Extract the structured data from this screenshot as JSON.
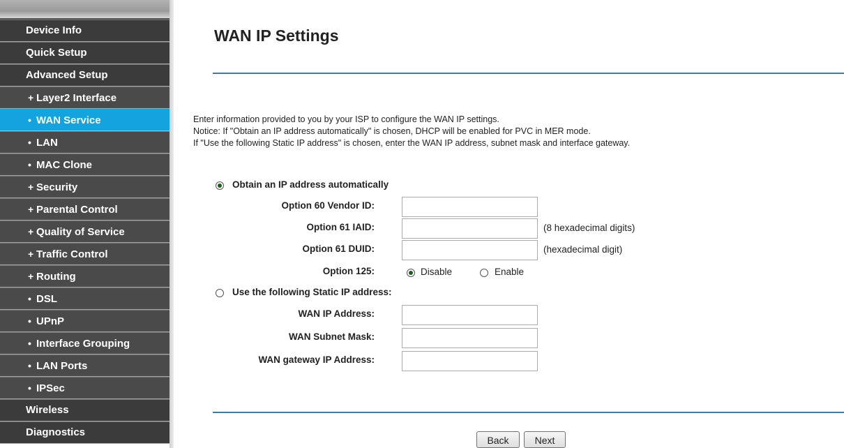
{
  "sidebar": {
    "items": [
      {
        "label": "Device Info",
        "type": "top"
      },
      {
        "label": "Quick Setup",
        "type": "top"
      },
      {
        "label": "Advanced Setup",
        "type": "top"
      },
      {
        "label": "Layer2 Interface",
        "type": "sub",
        "bullet": "+"
      },
      {
        "label": "WAN Service",
        "type": "sub",
        "bullet": "•",
        "active": true
      },
      {
        "label": "LAN",
        "type": "sub",
        "bullet": "•"
      },
      {
        "label": "MAC Clone",
        "type": "sub",
        "bullet": "•"
      },
      {
        "label": "Security",
        "type": "sub",
        "bullet": "+"
      },
      {
        "label": "Parental Control",
        "type": "sub",
        "bullet": "+"
      },
      {
        "label": "Quality of Service",
        "type": "sub",
        "bullet": "+"
      },
      {
        "label": "Traffic Control",
        "type": "sub",
        "bullet": "+"
      },
      {
        "label": "Routing",
        "type": "sub",
        "bullet": "+"
      },
      {
        "label": "DSL",
        "type": "sub",
        "bullet": "•"
      },
      {
        "label": "UPnP",
        "type": "sub",
        "bullet": "•"
      },
      {
        "label": "Interface Grouping",
        "type": "sub",
        "bullet": "•"
      },
      {
        "label": "LAN Ports",
        "type": "sub",
        "bullet": "•"
      },
      {
        "label": "IPSec",
        "type": "sub",
        "bullet": "•"
      },
      {
        "label": "Wireless",
        "type": "top"
      },
      {
        "label": "Diagnostics",
        "type": "top"
      }
    ]
  },
  "main": {
    "title": "WAN IP Settings",
    "description": [
      "Enter information provided to you by your ISP to configure the WAN IP settings.",
      "Notice: If \"Obtain an IP address automatically\" is chosen, DHCP will be enabled for PVC in MER mode.",
      "If \"Use the following Static IP address\" is chosen, enter the WAN IP address, subnet mask and interface gateway."
    ],
    "obtain_auto_label": "Obtain an IP address automatically",
    "option60_label": "Option 60 Vendor ID:",
    "option60_value": "",
    "option61_iaid_label": "Option 61 IAID:",
    "option61_iaid_value": "",
    "option61_iaid_hint": "(8 hexadecimal digits)",
    "option61_duid_label": "Option 61 DUID:",
    "option61_duid_value": "",
    "option61_duid_hint": "(hexadecimal digit)",
    "option125_label": "Option 125:",
    "option125_disable": "Disable",
    "option125_enable": "Enable",
    "static_label": "Use the following Static IP address:",
    "wan_ip_label": "WAN IP Address:",
    "wan_ip_value": "",
    "wan_mask_label": "WAN Subnet Mask:",
    "wan_mask_value": "",
    "wan_gw_label": "WAN gateway IP Address:",
    "wan_gw_value": "",
    "back_label": "Back",
    "next_label": "Next"
  },
  "colors": {
    "active": "#13a3de",
    "menu_bg": "#4a4a4a",
    "divider": "#3a7ca3"
  }
}
